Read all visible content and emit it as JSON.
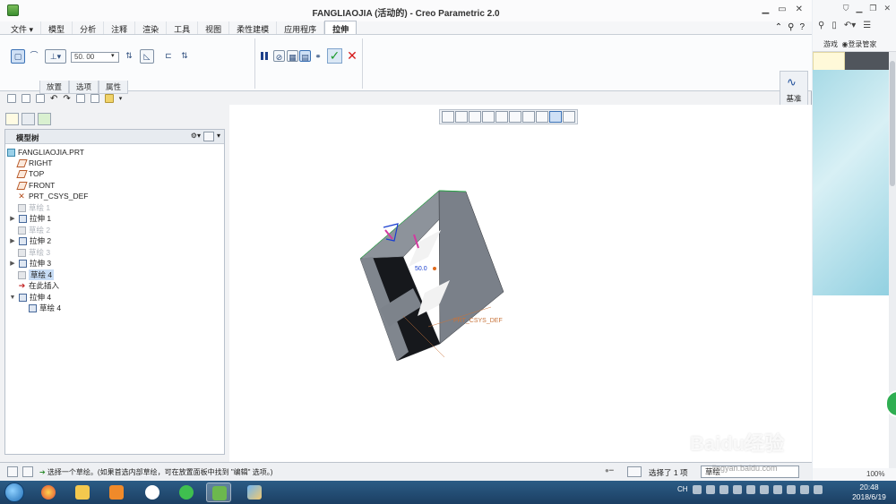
{
  "window": {
    "title": "FANGLIAOJIA (活动的) - Creo Parametric 2.0"
  },
  "menu": {
    "items": [
      "文件",
      "模型",
      "分析",
      "注释",
      "渲染",
      "工具",
      "视图",
      "柔性建模",
      "应用程序"
    ],
    "active_tab": "拉伸"
  },
  "ribbon": {
    "depth_value": "50. 00",
    "tabs": [
      "放置",
      "选项",
      "属性"
    ],
    "datum_label": "基准"
  },
  "tree": {
    "title": "模型树",
    "items": [
      {
        "label": "FANGLIAOJIA.PRT"
      },
      {
        "label": "RIGHT"
      },
      {
        "label": "TOP"
      },
      {
        "label": "FRONT"
      },
      {
        "label": "PRT_CSYS_DEF"
      },
      {
        "label": "草绘 1"
      },
      {
        "label": "拉伸 1"
      },
      {
        "label": "草绘 2"
      },
      {
        "label": "拉伸 2"
      },
      {
        "label": "草绘 3"
      },
      {
        "label": "拉伸 3"
      },
      {
        "label": "草绘 4"
      },
      {
        "label": "在此插入"
      },
      {
        "label": "拉伸 4"
      },
      {
        "label": "草绘 4"
      }
    ]
  },
  "viewport": {
    "dimension_label": "50.0",
    "csys_label": "PRT_CSYS_DEF"
  },
  "status": {
    "message": "选择一个草绘。(如果首选内部草绘，可在放置面板中找到 \"编辑\" 选项。)",
    "selection_count": "选择了 1 项",
    "filter_value": "草绘"
  },
  "browser": {
    "bookmark_games": "游戏",
    "bookmark_login": "登录管家",
    "zoom": "100%"
  },
  "watermark": {
    "text": "Baidu经验",
    "sub": "jingyan.baidu.com"
  },
  "taskbar": {
    "lang": "CH",
    "time": "20:48",
    "date": "2018/6/19"
  },
  "colors": {
    "accent": "#3a71b5",
    "model_gray": "#777f89",
    "model_dark": "#15171b",
    "csys_orange": "#c8733a",
    "ok_green": "#1d9a2c",
    "cancel_red": "#d51818"
  }
}
